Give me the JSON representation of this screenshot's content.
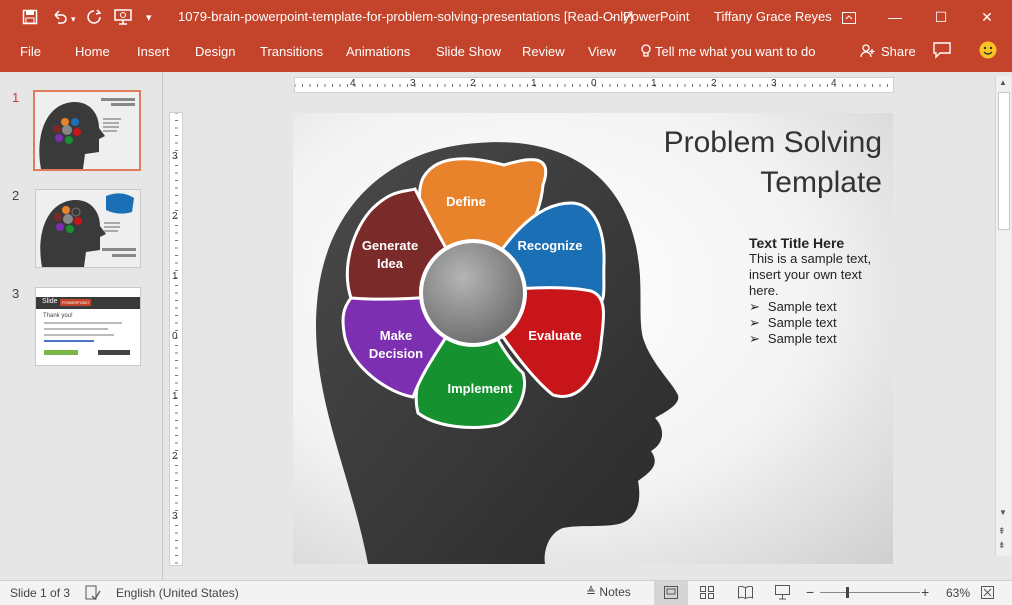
{
  "window": {
    "document_title": "1079-brain-powerpoint-template-for-problem-solving-presentations [Read-Only]",
    "separator": "-",
    "app_name": "PowerPoint",
    "user_name": "Tiffany Grace Reyes"
  },
  "quick_access": {
    "save_icon": "save-icon",
    "undo_icon": "undo-icon",
    "redo_icon": "redo-icon",
    "present_icon": "present-from-start-icon",
    "customize_icon": "customize-toolbar-icon"
  },
  "ribbon": {
    "tabs": [
      "File",
      "Home",
      "Insert",
      "Design",
      "Transitions",
      "Animations",
      "Slide Show",
      "Review",
      "View"
    ],
    "tell_me": "Tell me what you want to do",
    "share": "Share"
  },
  "thumbnails": {
    "numbers": [
      "1",
      "2",
      "3"
    ],
    "active": 1,
    "slide3": {
      "header": "Slide",
      "badge": "POWERPOINT",
      "thanks": "Thank you!"
    }
  },
  "rulers": {
    "h": [
      "4",
      "3",
      "2",
      "1",
      "0",
      "1",
      "2",
      "3",
      "4"
    ],
    "v": [
      "3",
      "2",
      "1",
      "0",
      "1",
      "2",
      "3"
    ]
  },
  "slide": {
    "title": "Problem Solving\nTemplate",
    "petals": [
      {
        "label": "Define",
        "color": "#e8822b"
      },
      {
        "label": "Recognize",
        "color": "#1a6fb5"
      },
      {
        "label": "Evaluate",
        "color": "#c8151a"
      },
      {
        "label": "Implement",
        "color": "#16912f"
      },
      {
        "label": "Make Decision",
        "color": "#7c2fb0"
      },
      {
        "label": "Generate Idea",
        "color": "#7b2a2a"
      }
    ],
    "text_title": "Text Title Here",
    "body_text": "This is a sample text, insert your own text here.",
    "bullets": [
      "Sample text",
      "Sample text",
      "Sample text"
    ]
  },
  "status": {
    "slide_info": "Slide 1 of 3",
    "language": "English (United States)",
    "notes": "Notes",
    "zoom": "63%"
  }
}
